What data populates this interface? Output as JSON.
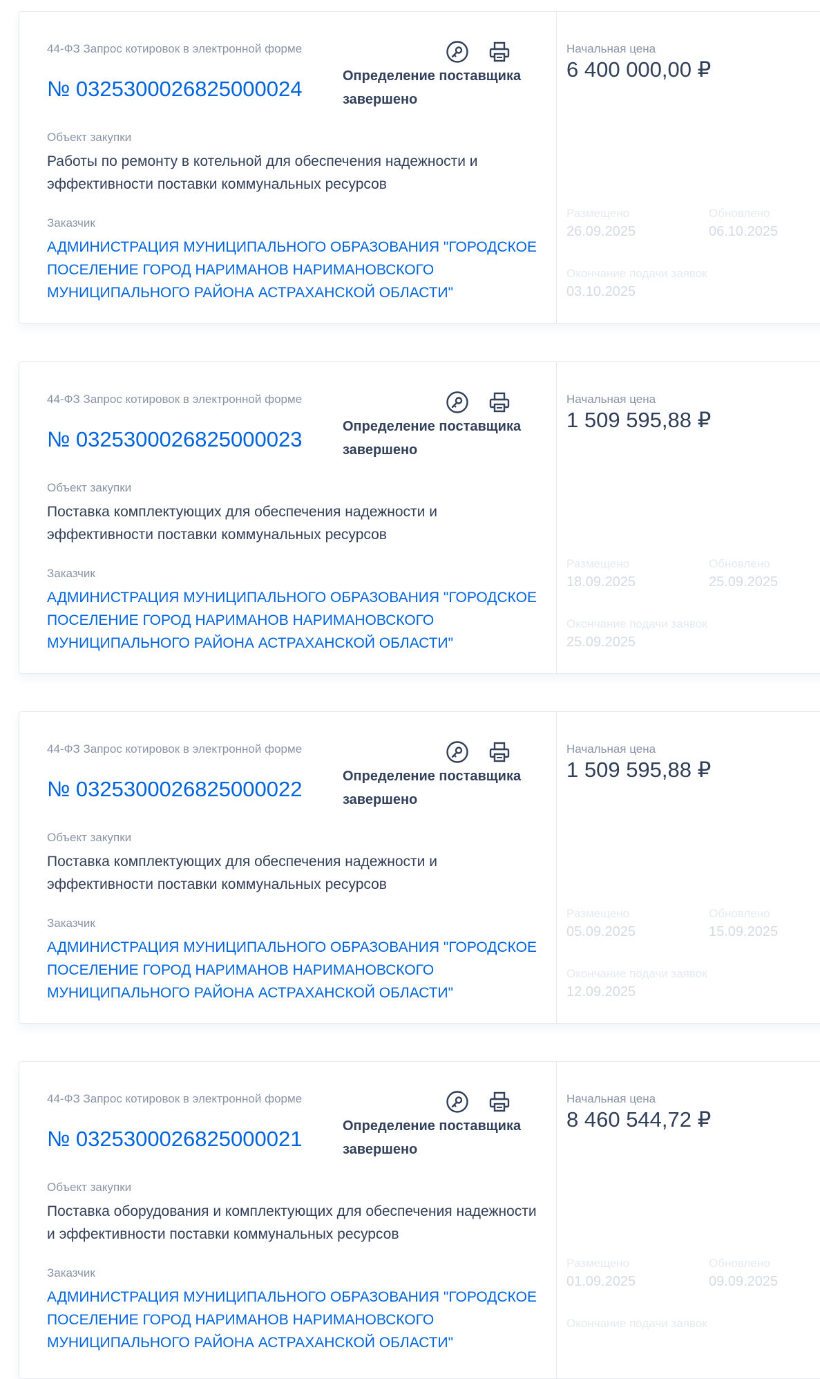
{
  "common": {
    "law_type": "44-ФЗ Запрос котировок в электронной форме",
    "status": "Определение поставщика завершено",
    "object_label": "Объект закупки",
    "customer_label": "Заказчик",
    "price_label": "Начальная цена",
    "posted_label": "Размещено",
    "updated_label": "Обновлено",
    "deadline_label": "Окончание подачи заявок",
    "customer": "АДМИНИСТРАЦИЯ МУНИЦИПАЛЬНОГО ОБРАЗОВАНИЯ \"ГОРОДСКОЕ ПОСЕЛЕНИЕ ГОРОД НАРИМАНОВ НАРИМАНОВСКОГО МУНИЦИПАЛЬНОГО РАЙОНА АСТРАХАНСКОЙ ОБЛАСТИ\"",
    "icons": {
      "sign": "digital-signature-icon",
      "print": "printer-icon"
    },
    "colors": {
      "link": "#0065dd",
      "text": "#334059",
      "muted": "#8a94a6",
      "faded": "#d5dbe4",
      "border": "#e6eaf0"
    }
  },
  "cards": [
    {
      "number": "№ 0325300026825000024",
      "object": "Работы по ремонту в котельной для обеспечения надежности и эффективности поставки коммунальных ресурсов",
      "price": "6 400 000,00 ₽",
      "posted": "26.09.2025",
      "updated": "06.10.2025",
      "deadline": "03.10.2025"
    },
    {
      "number": "№ 0325300026825000023",
      "object": "Поставка комплектующих для обеспечения надежности и эффективности поставки коммунальных ресурсов",
      "price": "1 509 595,88 ₽",
      "posted": "18.09.2025",
      "updated": "25.09.2025",
      "deadline": "25.09.2025"
    },
    {
      "number": "№ 0325300026825000022",
      "object": "Поставка комплектующих для обеспечения надежности и эффективности поставки коммунальных ресурсов",
      "price": "1 509 595,88 ₽",
      "posted": "05.09.2025",
      "updated": "15.09.2025",
      "deadline": "12.09.2025"
    },
    {
      "number": "№ 0325300026825000021",
      "object": "Поставка оборудования и комплектующих для обеспечения надежности и эффективности поставки коммунальных ресурсов",
      "price": "8 460 544,72 ₽",
      "posted": "01.09.2025",
      "updated": "09.09.2025",
      "deadline": ""
    }
  ]
}
